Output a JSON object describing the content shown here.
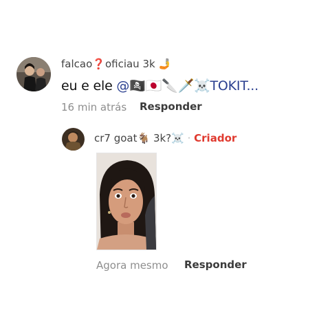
{
  "comment1": {
    "username": "falcao",
    "username_badge": "❓",
    "username_suffix": "oficiau 3k",
    "username_emoji": "🤳",
    "text_prefix": "eu e ele ",
    "mention": "@🏴‍☠️🇯🇵🔪🗡️☠️TOKIT...",
    "time": "16 min atrás",
    "reply_label": "Responder"
  },
  "comment2": {
    "username": "cr7 goat🐐 3k?☠️",
    "separator": "·",
    "creator_label": "Criador",
    "time": "Agora mesmo",
    "reply_label": "Responder"
  },
  "colors": {
    "creator": "#e03a2f",
    "time": "#8e8e8e",
    "reply": "#3b3b3b"
  }
}
